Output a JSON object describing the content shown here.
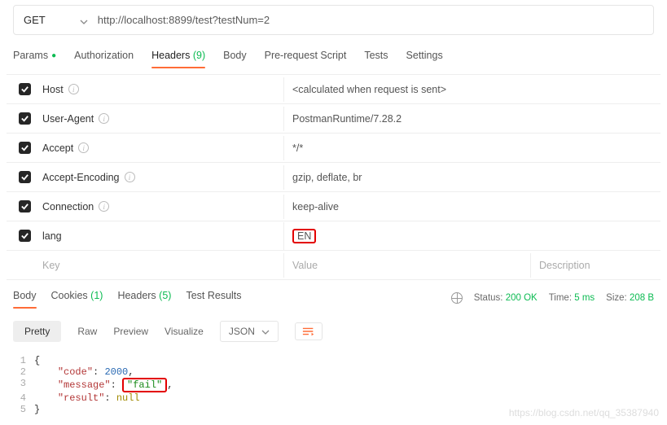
{
  "request": {
    "method": "GET",
    "url": "http://localhost:8899/test?testNum=2"
  },
  "tabs": {
    "params": "Params",
    "auth": "Authorization",
    "headers": "Headers",
    "headers_count": "(9)",
    "body": "Body",
    "prerequest": "Pre-request Script",
    "tests": "Tests",
    "settings": "Settings"
  },
  "headers": [
    {
      "key": "Host",
      "value": "<calculated when request is sent>",
      "system": true
    },
    {
      "key": "User-Agent",
      "value": "PostmanRuntime/7.28.2",
      "system": true
    },
    {
      "key": "Accept",
      "value": "*/*",
      "system": true
    },
    {
      "key": "Accept-Encoding",
      "value": "gzip, deflate, br",
      "system": true
    },
    {
      "key": "Connection",
      "value": "keep-alive",
      "system": true
    },
    {
      "key": "lang",
      "value": "EN",
      "system": false,
      "highlight": true
    }
  ],
  "placeholder": {
    "key": "Key",
    "value": "Value",
    "desc": "Description"
  },
  "response": {
    "tabs": {
      "body": "Body",
      "cookies": "Cookies",
      "cookies_count": "(1)",
      "headers": "Headers",
      "headers_count": "(5)",
      "tests": "Test Results"
    },
    "status_label": "Status:",
    "status_code": "200 OK",
    "time_label": "Time:",
    "time_value": "5 ms",
    "size_label": "Size:",
    "size_value": "208 B",
    "view": {
      "pretty": "Pretty",
      "raw": "Raw",
      "preview": "Preview",
      "visualize": "Visualize",
      "type": "JSON"
    },
    "json": {
      "open": "{",
      "close": "}",
      "line2_key": "\"code\"",
      "line2_val": "2000",
      "line2_punc": ",",
      "line3_key": "\"message\"",
      "line3_val": "\"fail\"",
      "line3_punc": ",",
      "line4_key": "\"result\"",
      "line4_val": "null"
    }
  },
  "watermark": "https://blog.csdn.net/qq_35387940"
}
